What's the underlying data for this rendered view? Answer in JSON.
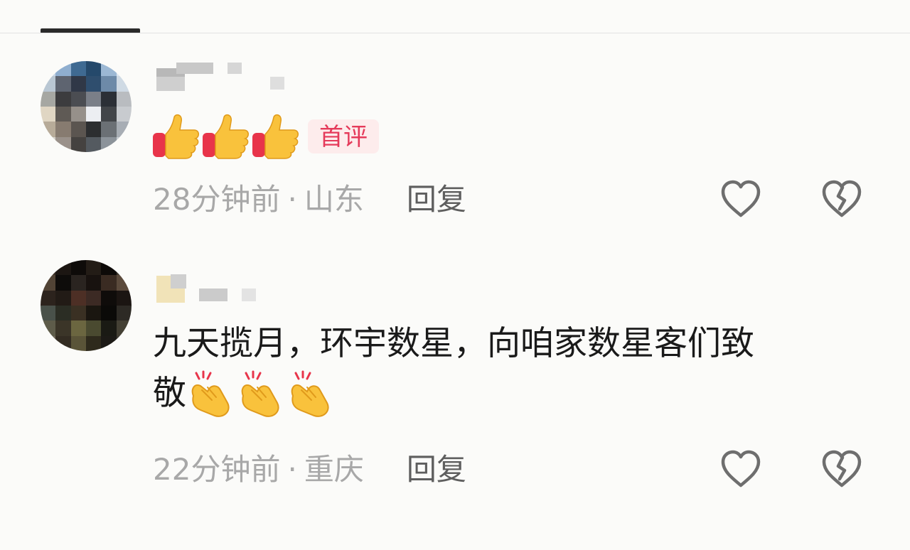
{
  "comments": [
    {
      "badge": "首评",
      "time": "28分钟前",
      "separator": "·",
      "location": "山东",
      "reply_label": "回复",
      "content_emoji": "thumbs-up ×3"
    },
    {
      "text_line1": "九天揽月，环宇数星，向咱家数星客们致",
      "text_line2": "敬",
      "content_emoji": "clapping-hands ×3",
      "time": "22分钟前",
      "separator": "·",
      "location": "重庆",
      "reply_label": "回复"
    }
  ],
  "icons": {
    "like": "heart-outline-icon",
    "dislike": "broken-heart-icon",
    "reaction_emoji_1": "thumbs-up-icon",
    "reaction_emoji_2": "clapping-hands-icon"
  },
  "colors": {
    "background": "#fbfbf9",
    "badge_bg": "#fdecec",
    "badge_text": "#e53a5a",
    "meta_text": "#a8a8a8",
    "reply_text": "#5e5e5e",
    "icon_stroke": "#6e6e6e"
  }
}
